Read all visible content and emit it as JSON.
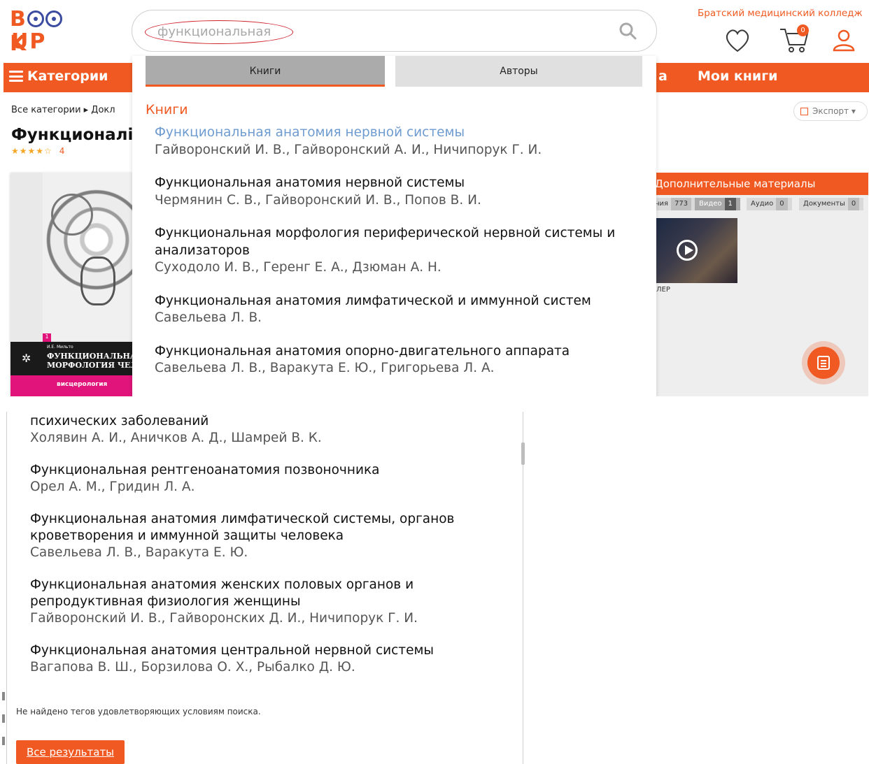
{
  "logo": {
    "line1_a": "B",
    "line1_b": "K",
    "line2": "UP"
  },
  "search": {
    "value": "функциональная"
  },
  "header": {
    "college": "Братский медицинский колледж",
    "cart_count": "0"
  },
  "nav": {
    "categories": "Категории",
    "fragment": "а",
    "my_books": "Мои книги"
  },
  "breadcrumb": "Все категории  ▸  Докл",
  "export": {
    "label": "Экспорт ▾"
  },
  "page": {
    "title": "Функционалі",
    "rating_count": "4",
    "rating": 4.5
  },
  "cover": {
    "badge": "1",
    "author": "И.Е. Мильто",
    "title_line1": "ФУНКЦИОНАЛЬНАЯ",
    "title_line2": "МОРФОЛОГИЯ ЧЕЛ",
    "subtitle": "висцерология"
  },
  "side": {
    "heading": "Дополнительные материалы",
    "tabs": [
      {
        "label": "ния",
        "count": "773"
      },
      {
        "label": "Видео",
        "count": "1"
      },
      {
        "label": "Аудио",
        "count": "0"
      },
      {
        "label": "Документы",
        "count": "0"
      }
    ],
    "video_caption": "ЛЕР"
  },
  "dropdown": {
    "tabs": [
      "Книги",
      "Авторы"
    ],
    "heading": "Книги",
    "results_top": [
      {
        "title": "Функциональная анатомия нервной системы",
        "authors": "Гайворонский И. В., Гайворонский А. И., Ничипорук Г. И."
      },
      {
        "title": "Функциональная анатомия нервной системы",
        "authors": "Чермянин С. В., Гайворонский И. В., Попов В. И."
      },
      {
        "title": "Функциональная морфология периферической нервной системы и анализаторов",
        "authors": "Суходоло И. В., Геренг Е. А., Дзюман А. Н."
      },
      {
        "title": "Функциональная анатомия лимфатической и иммунной систем",
        "authors": "Савельева Л. В."
      },
      {
        "title": "Функциональная анатомия опорно-двигательного аппарата",
        "authors": "Савельева Л. В., Варакута Е. Ю., Григорьева Л. А."
      }
    ],
    "results_bottom": [
      {
        "title": "психических заболеваний",
        "authors": "Холявин А. И., Аничков А. Д., Шамрей В. К."
      },
      {
        "title": "Функциональная рентгеноанатомия позвоночника",
        "authors": "Орел А. М., Гридин Л. А."
      },
      {
        "title": "Функциональная анатомия лимфатической системы, органов кроветворения и иммунной защиты человека",
        "authors": "Савельева Л. В., Варакута Е. Ю."
      },
      {
        "title": "Функциональная анатомия женских половых органов и репродуктивная физиология женщины",
        "authors": "Гайворонский И. В., Гайворонских Д. И., Ничипорук Г. И."
      },
      {
        "title": "Функциональная анатомия центральной нервной системы",
        "authors": "Вагапова В. Ш., Борзилова О. Х., Рыбалко Д. Ю."
      }
    ],
    "not_found": "Не найдено тегов удовлетворяющих условиям поиска.",
    "all_results": "Все результаты"
  },
  "colors": {
    "accent": "#f05a22",
    "link_highlight": "#6e9bd0",
    "logo_blue": "#3a4ba0"
  },
  "icons": [
    "search-icon",
    "heart-icon",
    "cart-icon",
    "user-icon",
    "menu-icon",
    "export-icon",
    "play-icon",
    "document-icon"
  ]
}
